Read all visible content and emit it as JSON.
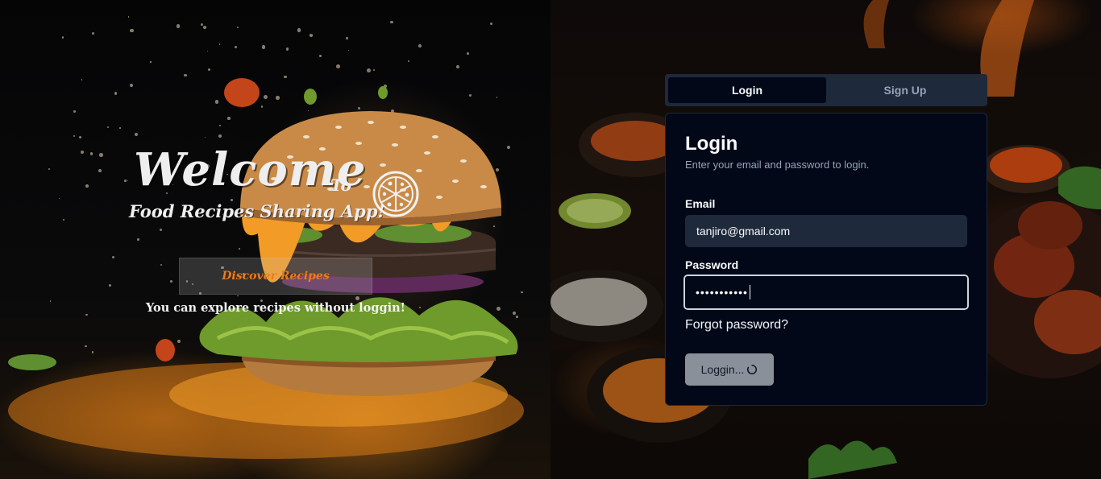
{
  "hero": {
    "welcome_word": "Welcome",
    "welcome_to": "To",
    "app_name": "Food Recipes Sharing App!",
    "discover_button": "Discover Recipes",
    "explore_note": "You can explore recipes without loggin!"
  },
  "auth": {
    "tabs": [
      {
        "label": "Login",
        "active": true
      },
      {
        "label": "Sign Up",
        "active": false
      }
    ],
    "title": "Login",
    "description": "Enter your email and password to login.",
    "email_label": "Email",
    "email_value": "tanjiro@gmail.com",
    "password_label": "Password",
    "password_mask": "•••••••••••",
    "forgot_link": "Forgot password?",
    "submit_label": "Loggin..."
  },
  "colors": {
    "accent_orange": "#f07a15",
    "card_bg": "#020817",
    "tab_bg": "#1e293b",
    "muted_text": "#94a3b8",
    "button_disabled": "#8a9099"
  },
  "icons": {
    "logo": "pizza-icon",
    "loading": "spinner-icon"
  }
}
